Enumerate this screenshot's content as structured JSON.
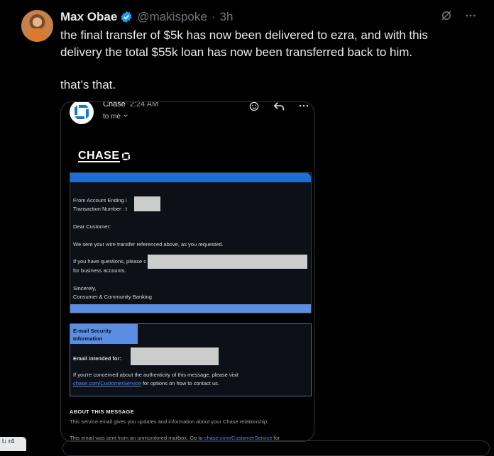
{
  "post": {
    "author_name": "Max Obae",
    "handle": "@makispoke",
    "separator": "·",
    "time_ago": "3h",
    "text_line_1": "the final transfer of $5k has now been delivered to ezra, and with this delivery the total $55k loan has now been transferred back to him.",
    "text_line_2": "that’s that."
  },
  "email": {
    "sender": "Chase",
    "time": "2:24 AM",
    "to": "to me",
    "brand_wordmark": "CHASE",
    "from_label": "From Account Ending i",
    "txn_label": "Transaction Number :",
    "txn_suffix": "t",
    "greeting": "Dear Customer:",
    "body": "We sent your wire transfer referenced above, as you requested.",
    "questions": "If you have questions, please c",
    "business": "for business accounts.",
    "closing": "Sincerely,",
    "signature": "Consumer & Community Banking",
    "security_header": "E-mail Security Information",
    "intended_label": "Email intended for:",
    "concern_text": "If you're concerned about the authenticity of this message, please visit",
    "concern_link": "chase.com/CustomerService",
    "concern_tail": "for options on how to contact us.",
    "about_title": "ABOUT THIS MESSAGE",
    "about_body": "This service email gives you updates and information about your Chase relationship.",
    "about_body2_start": "This email was sent from an unmonitored mailbox. Go to",
    "about_link": "chase.com/CustomerService",
    "about_body2_end": "for"
  },
  "corner_text": "l↓ r4",
  "colors": {
    "background": "#000000",
    "verified": "#1d9bf0",
    "chase_blue": "#1d6fd6",
    "link": "#4f8ef7"
  }
}
